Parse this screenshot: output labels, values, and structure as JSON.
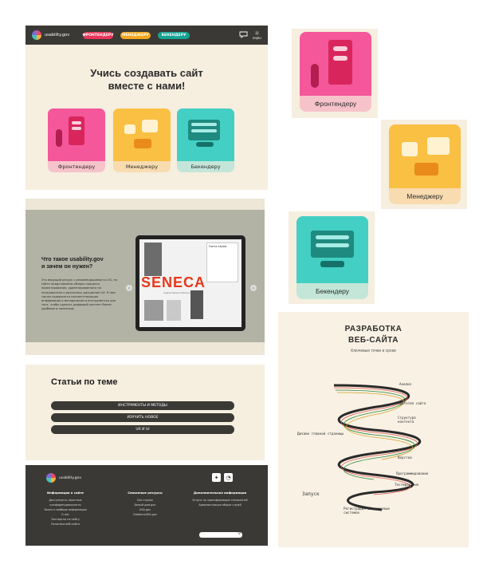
{
  "header": {
    "logo_text": "usability.gov",
    "nav": [
      {
        "label": "ФРОНТЕНДЕРУ",
        "color": "#e8365a"
      },
      {
        "label": "МЕНЕДЖЕРУ",
        "color": "#f2a81e"
      },
      {
        "label": "БЕКЕНДЕРУ",
        "color": "#16a395"
      }
    ],
    "lang": "EN|RU"
  },
  "hero": {
    "title_line1": "Учись создавать сайт",
    "title_line2": "вместе с нами!",
    "cards": [
      {
        "label": "Фронтендеру"
      },
      {
        "label": "Менеджеру"
      },
      {
        "label": "Бекендеру"
      }
    ]
  },
  "about": {
    "title_line1": "Что такое usability.gov",
    "title_line2": "и зачем он нужен?",
    "text": "Это ведущий ресурс с рекомендациями по UX, на сайте представлены обзоры процесса проектирования, ориентированного на пользователя и различных дисциплин UX. Я нем также содержатся соответствующая информация о методологии и инструментах для того, чтобы сделать цифровой контент более удобным и полезным.",
    "slide_brand": "SENECA",
    "slide_caption": "Forms styled",
    "slide_note": "Inspired Seneca Thinking Works",
    "prev": "‹",
    "next": "›"
  },
  "articles": {
    "title": "Статьи по теме",
    "buttons": [
      "ИНСТРУМЕНТЫ И МЕТОДЫ",
      "ИЗУЧИТЬ НОВОЕ",
      "UX И UI"
    ]
  },
  "footer": {
    "logo_text": "usability.gov",
    "col1": {
      "title": "Информация о сайте",
      "items": [
        "Доступность пакетных конфиденциальности",
        "Закон о свободе информации",
        "О нас",
        "Экспортно по сайту",
        "Политика веб-сайта"
      ]
    },
    "col2": {
      "title": "Связанные ресурсы",
      "items": [
        "Без страха",
        "Белый дом.gov",
        "USA.gov",
        "GobiernoUSA.gov"
      ]
    },
    "col3": {
      "title": "Дополнительная информация",
      "items": [
        "Услуги по трансформации технологий",
        "Администрация общих служб"
      ]
    }
  },
  "side_cards": [
    {
      "label": "Фронтендеру"
    },
    {
      "label": "Менеджеру"
    },
    {
      "label": "Бекендеру"
    }
  ],
  "roadmap": {
    "title_line1": "РАЗРАБОТКА",
    "title_line2": "ВЕБ-САЙТА",
    "subtitle": "Ключевые точки и сроки",
    "labels": [
      "Анализ",
      "Прототип сайта",
      "Структура контента",
      "Дизайн главной страницы",
      "Верстка",
      "Программирование",
      "Тестирование",
      "Запуск",
      "Регистрация в поисковых системах"
    ]
  },
  "colors": {
    "panel": "#f6eedf",
    "dark": "#3b3935",
    "pink": "#f4579a",
    "orange": "#f9c043",
    "teal": "#43cfc3"
  }
}
